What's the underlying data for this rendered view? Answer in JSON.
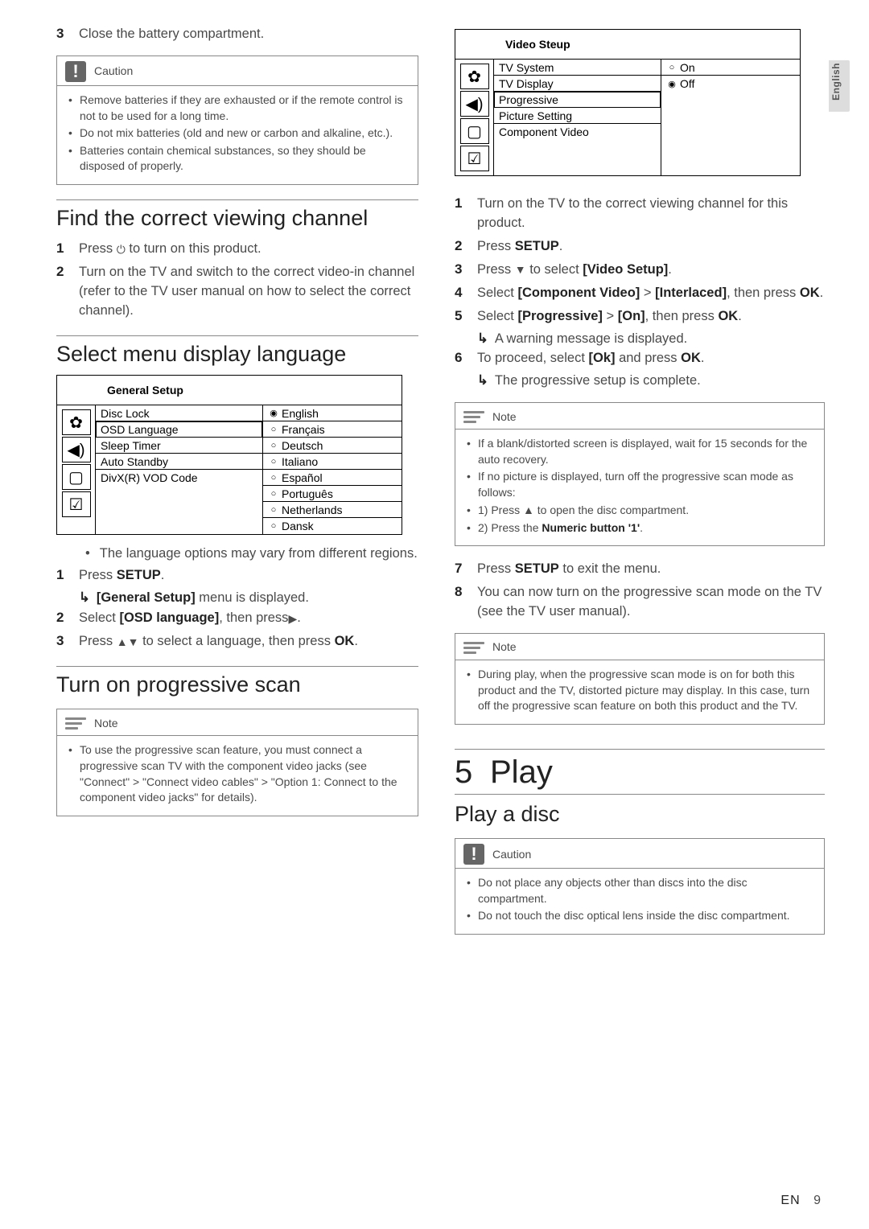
{
  "tab": {
    "label": "English"
  },
  "left": {
    "step3": {
      "num": "3",
      "text": "Close the battery compartment."
    },
    "caution1": {
      "title": "Caution",
      "items": [
        "Remove batteries if they are exhausted or if the remote control is not to be used for a long time.",
        "Do not mix batteries (old and new or carbon and alkaline, etc.).",
        "Batteries contain chemical substances, so they should be disposed of properly."
      ]
    },
    "sec_find": {
      "title": "Find the correct viewing channel",
      "s1_num": "1",
      "s1_a": "Press ",
      "s1_sym": "⏻",
      "s1_b": " to turn on this product.",
      "s2_num": "2",
      "s2": "Turn on the TV and switch to the correct video-in channel (refer to the TV user manual on how to select the correct channel)."
    },
    "sec_lang": {
      "title": "Select menu display language",
      "osd_title": "General Setup",
      "mid": [
        "Disc Lock",
        "OSD Language",
        "Sleep Timer",
        "Auto Standby",
        "DivX(R) VOD Code"
      ],
      "opts": [
        "English",
        "Français",
        "Deutsch",
        "Italiano",
        "Español",
        "Português",
        "Netherlands",
        "Dansk"
      ],
      "note": "The language options may vary from different regions.",
      "s1_num": "1",
      "s1_a": "Press ",
      "s1_b": "SETUP",
      "s1_c": ".",
      "s1_sub_a": "[General Setup]",
      "s1_sub_b": " menu is displayed.",
      "s2_num": "2",
      "s2_a": "Select ",
      "s2_b": "[OSD language]",
      "s2_c": ", then press",
      "s2_sym": "▶",
      "s2_d": ".",
      "s3_num": "3",
      "s3_a": "Press ",
      "s3_sym": "▲▼",
      "s3_b": " to select a language, then press ",
      "s3_c": "OK",
      "s3_d": "."
    },
    "sec_prog": {
      "title": "Turn on progressive scan",
      "note_title": "Note",
      "note_item": "To use the progressive scan feature, you must connect a progressive scan TV with the component video jacks (see \"Connect\" > \"Connect video cables\" > \"Option 1: Connect to the component video jacks\" for details)."
    }
  },
  "right": {
    "osd": {
      "title": "Video Steup",
      "mid": [
        "TV System",
        "TV Display",
        "Progressive",
        "Picture Setting",
        "Component Video"
      ],
      "opts": [
        "On",
        "Off"
      ]
    },
    "steps": {
      "s1_num": "1",
      "s1": "Turn on the TV to the correct viewing channel for this product.",
      "s2_num": "2",
      "s2_a": "Press ",
      "s2_b": "SETUP",
      "s2_c": ".",
      "s3_num": "3",
      "s3_a": "Press ",
      "s3_sym": "▼",
      "s3_b": " to select ",
      "s3_c": "[Video Setup]",
      "s3_d": ".",
      "s4_num": "4",
      "s4_a": "Select ",
      "s4_b": "[Component Video]",
      "s4_c": " > ",
      "s4_d": "[Interlaced]",
      "s4_e": ", then press ",
      "s4_f": "OK",
      "s4_g": ".",
      "s5_num": "5",
      "s5_a": "Select ",
      "s5_b": "[Progressive]",
      "s5_c": " > ",
      "s5_d": "[On]",
      "s5_e": ", then press ",
      "s5_f": "OK",
      "s5_g": ".",
      "s5_sub": "A warning message is displayed.",
      "s6_num": "6",
      "s6_a": "To proceed, select ",
      "s6_b": "[Ok]",
      "s6_c": " and press ",
      "s6_d": "OK",
      "s6_e": ".",
      "s6_sub": "The progressive setup is complete."
    },
    "note1": {
      "title": "Note",
      "items_a": "If a blank/distorted screen is displayed, wait for 15 seconds for the auto recovery.",
      "items_b": "If no picture is displayed, turn off the progressive scan mode as follows:",
      "items_c_a": "1) Press ",
      "items_c_sym": "▲",
      "items_c_b": " to open the disc compartment.",
      "items_d_a": "2) Press the ",
      "items_d_b": "Numeric button '1'",
      "items_d_c": "."
    },
    "s7_num": "7",
    "s7_a": "Press ",
    "s7_b": "SETUP",
    "s7_c": " to exit the menu.",
    "s8_num": "8",
    "s8": "You can now turn on the progressive scan mode on the TV (see the TV user manual).",
    "note2": {
      "title": "Note",
      "item": "During play, when the progressive scan mode is on for both this product and the TV, distorted picture may display. In this case, turn off the progressive scan feature on both this product and the TV."
    },
    "chapter": {
      "num": "5",
      "title": "Play"
    },
    "sec_disc": {
      "title": "Play a disc",
      "caution_title": "Caution",
      "items": [
        "Do not place any objects other than discs into the disc compartment.",
        "Do not touch the disc optical lens inside the disc compartment."
      ]
    }
  },
  "footer": {
    "en": "EN",
    "num": "9"
  }
}
